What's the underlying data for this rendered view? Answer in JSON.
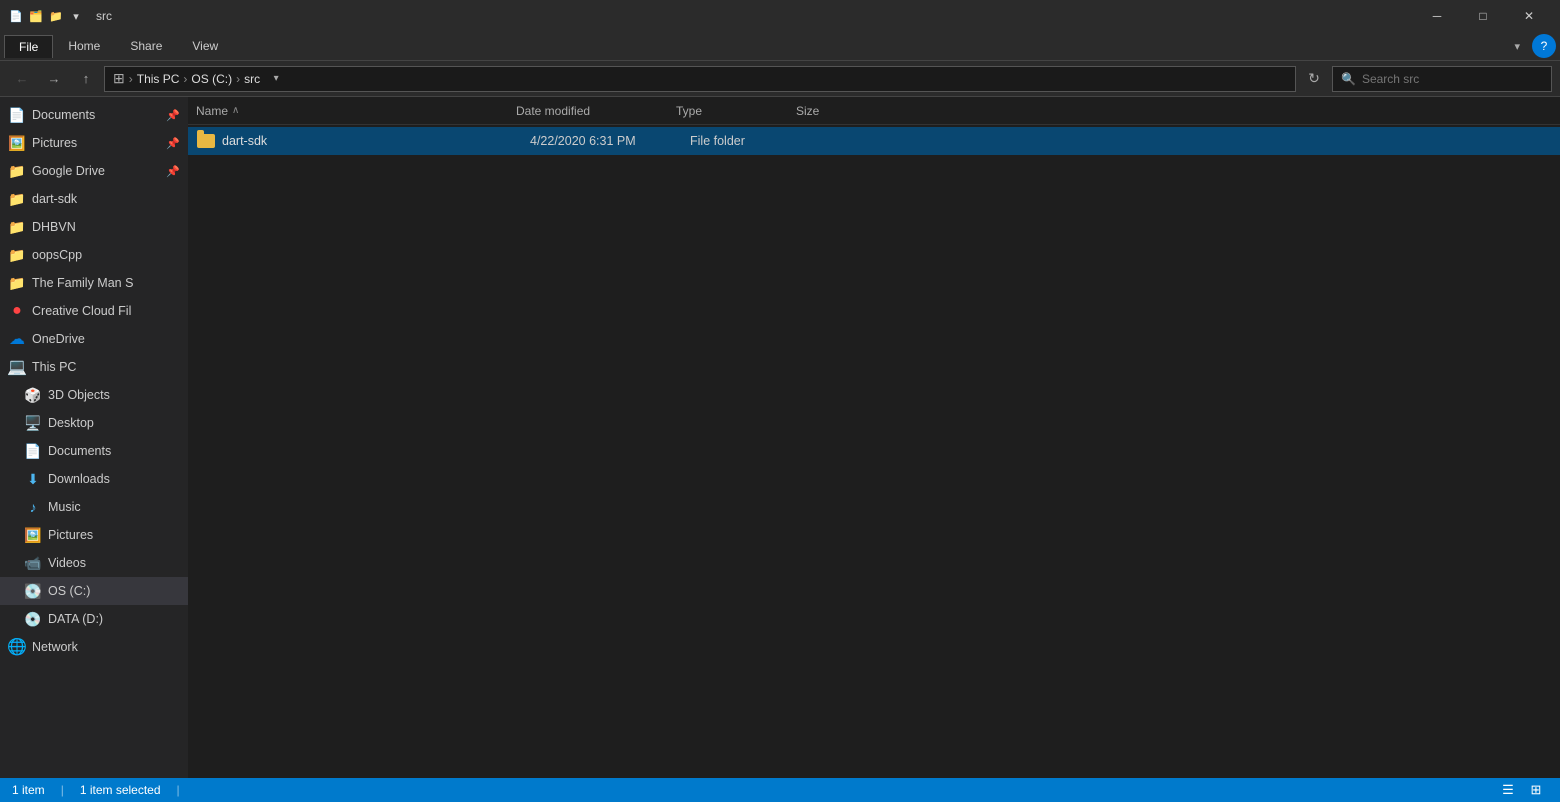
{
  "titleBar": {
    "icons": [
      "📄",
      "🗂️",
      "📁"
    ],
    "title": "src",
    "minimize": "─",
    "maximize": "□",
    "close": "✕"
  },
  "ribbon": {
    "tabs": [
      "File",
      "Home",
      "Share",
      "View"
    ],
    "activeTab": "File",
    "helpText": "?"
  },
  "addressBar": {
    "backBtn": "←",
    "forwardBtn": "→",
    "upBtn": "↑",
    "breadcrumb": [
      {
        "label": "This PC",
        "separator": ">"
      },
      {
        "label": "OS (C:)",
        "separator": ">"
      },
      {
        "label": "src",
        "separator": ""
      }
    ],
    "dropdownArrow": "▾",
    "refreshIcon": "↻",
    "searchPlaceholder": "Search src"
  },
  "sidebar": {
    "quickAccess": [
      {
        "label": "Documents",
        "icon": "📄",
        "pinned": true
      },
      {
        "label": "Pictures",
        "icon": "🖼️",
        "pinned": true
      },
      {
        "label": "Google Drive",
        "icon": "📁",
        "pinned": true
      },
      {
        "label": "dart-sdk",
        "icon": "📁",
        "pinned": false
      },
      {
        "label": "DHBVN",
        "icon": "📁",
        "pinned": false
      },
      {
        "label": "oopsCpp",
        "icon": "📁",
        "pinned": false
      },
      {
        "label": "The Family Man S",
        "icon": "📁",
        "pinned": false
      }
    ],
    "creativeCloud": {
      "label": "Creative Cloud Fil",
      "icon": "🔴"
    },
    "oneDrive": {
      "label": "OneDrive",
      "icon": "☁️"
    },
    "thisPC": {
      "label": "This PC",
      "icon": "💻",
      "children": [
        {
          "label": "3D Objects",
          "icon": "🎲"
        },
        {
          "label": "Desktop",
          "icon": "🖥️"
        },
        {
          "label": "Documents",
          "icon": "📄"
        },
        {
          "label": "Downloads",
          "icon": "⬇️"
        },
        {
          "label": "Music",
          "icon": "🎵"
        },
        {
          "label": "Pictures",
          "icon": "🖼️"
        },
        {
          "label": "Videos",
          "icon": "📹"
        },
        {
          "label": "OS (C:)",
          "icon": "💽",
          "active": true
        },
        {
          "label": "DATA (D:)",
          "icon": "💿"
        }
      ]
    },
    "network": {
      "label": "Network",
      "icon": "🌐"
    }
  },
  "columns": {
    "name": {
      "label": "Name",
      "sortArrow": "∧"
    },
    "dateModified": {
      "label": "Date modified"
    },
    "type": {
      "label": "Type"
    },
    "size": {
      "label": "Size"
    }
  },
  "files": [
    {
      "name": "dart-sdk",
      "dateModified": "4/22/2020 6:31 PM",
      "type": "File folder",
      "size": "",
      "selected": true
    }
  ],
  "statusBar": {
    "itemCount": "1 item",
    "separator1": "|",
    "selectedCount": "1 item selected",
    "separator2": "|"
  }
}
